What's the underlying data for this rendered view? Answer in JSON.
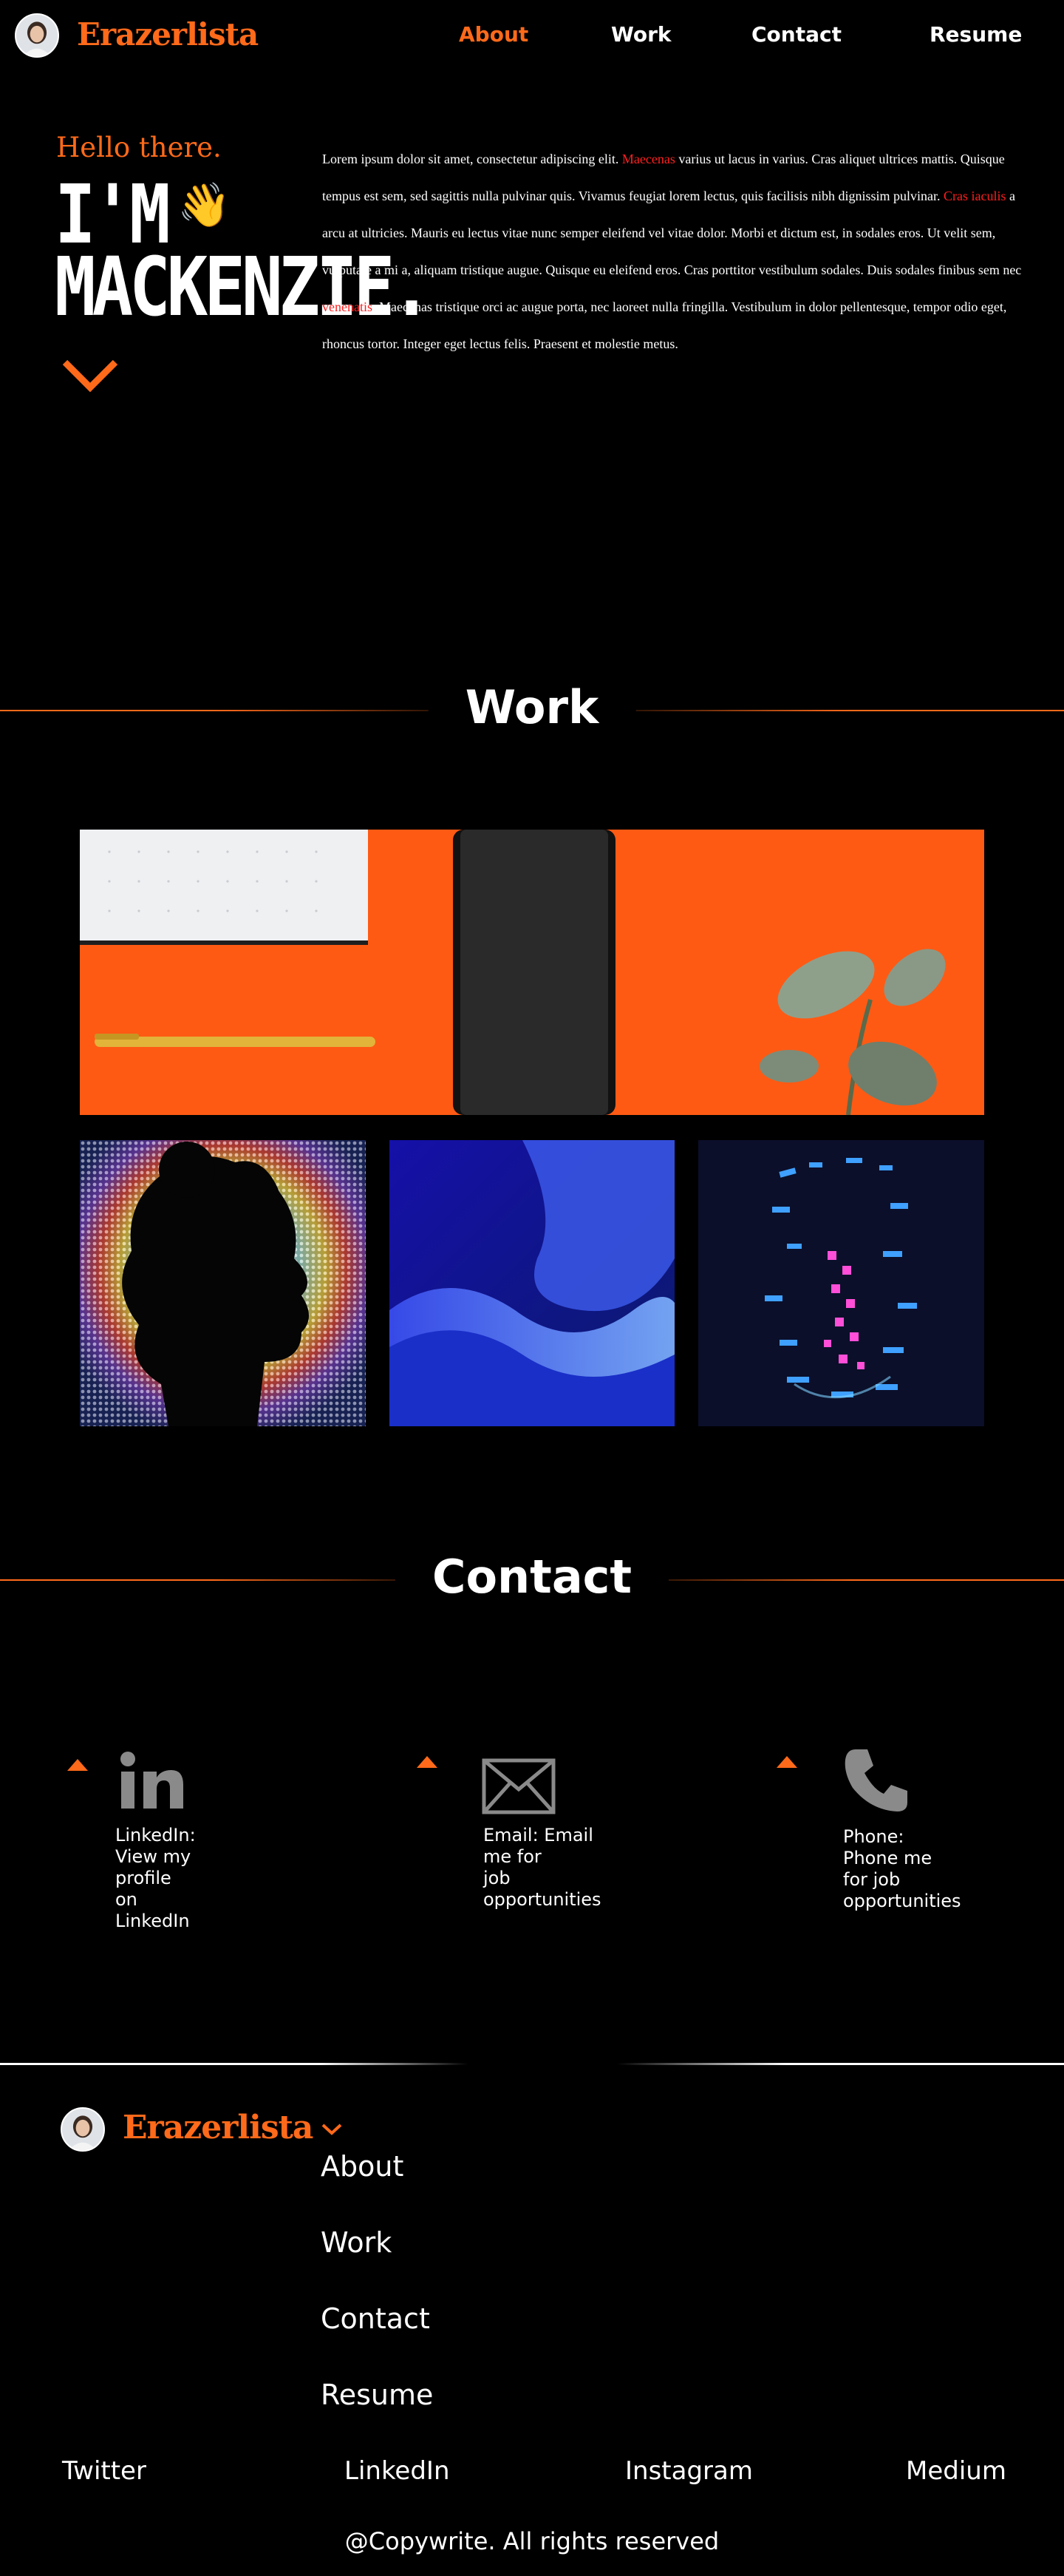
{
  "header": {
    "brand": "Erazerlista",
    "nav": [
      "About",
      "Work",
      "Contact",
      "Resume"
    ],
    "active": "About"
  },
  "hero": {
    "greeting": "Hello there.",
    "name_line1": "I'M",
    "name_line2": "MACKENZIE.",
    "wave": "👋",
    "paragraph": [
      {
        "t": "Lorem ipsum dolor sit amet, consectetur adipiscing elit. "
      },
      {
        "t": "Maecenas",
        "link": true
      },
      {
        "t": " varius ut lacus in varius. Cras aliquet ultrices mattis. Quisque tempus est sem, sed sagittis nulla pulvinar quis. Vivamus feugiat lorem lectus, quis facilisis nibh dignissim pulvinar. "
      },
      {
        "t": "Cras iaculis",
        "link": true
      },
      {
        "t": " a arcu at ultricies. Mauris eu lectus vitae nunc semper eleifend vel vitae dolor. Morbi et dictum est, in sodales eros. Ut velit sem, vulputate a mi a, aliquam tristique augue. Quisque eu eleifend eros. Cras porttitor vestibulum sodales. Duis sodales finibus sem nec "
      },
      {
        "t": "venenatis",
        "link": true
      },
      {
        "t": ". Maecenas tristique orci ac augue porta, nec laoreet nulla fringilla. Vestibulum in dolor pellentesque, tempor odio eget, rhoncus tortor. Integer eget lectus felis. Praesent et molestie metus."
      }
    ]
  },
  "work": {
    "title": "Work"
  },
  "contact": {
    "title": "Contact",
    "items": [
      {
        "icon": "linkedin-icon",
        "line1": "LinkedIn: View my",
        "line2": "profile on LinkedIn"
      },
      {
        "icon": "mail-icon",
        "line1": "Email: Email me for",
        "line2": "job opportunities"
      },
      {
        "icon": "phone-icon",
        "line1": "Phone: Phone me",
        "line2": "for job opportunities"
      }
    ]
  },
  "footer": {
    "brand": "Erazerlista",
    "nav": [
      "About",
      "Work",
      "Contact",
      "Resume"
    ],
    "social": [
      "Twitter",
      "LinkedIn",
      "Instagram",
      "Medium"
    ],
    "copyright": "@Copywrite. All rights reserved"
  },
  "colors": {
    "accent": "#ff6a1a",
    "link_red": "#ff1f1f",
    "background": "#000000",
    "text": "#ffffff"
  }
}
